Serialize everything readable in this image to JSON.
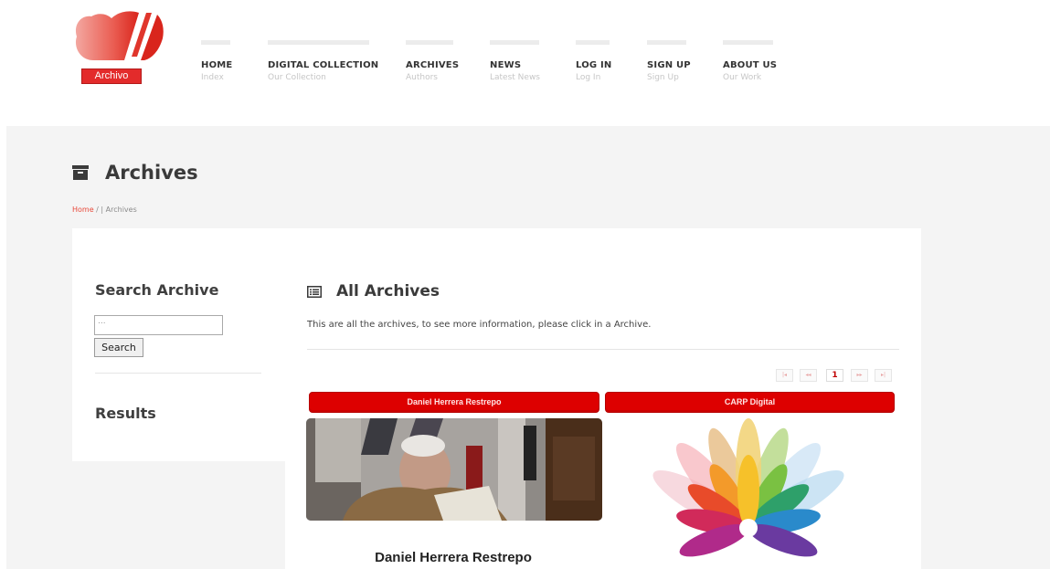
{
  "header": {
    "logo_text": "Archivo",
    "nav": [
      {
        "title": "HOME",
        "subtitle": "Index"
      },
      {
        "title": "DIGITAL COLLECTION",
        "subtitle": "Our Collection"
      },
      {
        "title": "ARCHIVES",
        "subtitle": "Authors"
      },
      {
        "title": "NEWS",
        "subtitle": "Latest News"
      },
      {
        "title": "LOG IN",
        "subtitle": "Log In"
      },
      {
        "title": "SIGN UP",
        "subtitle": "Sign Up"
      },
      {
        "title": "ABOUT US",
        "subtitle": "Our Work"
      }
    ]
  },
  "page": {
    "title": "Archives",
    "breadcrumb": {
      "home": "Home",
      "separator": "/  |",
      "current": "Archives"
    }
  },
  "sidebar": {
    "search_heading": "Search Archive",
    "search_placeholder": "...",
    "search_button": "Search",
    "results_heading": "Results"
  },
  "main": {
    "heading": "All Archives",
    "description": "This are all the archives, to see more information, please click in a Archive.",
    "pagination": {
      "first": "|◂",
      "prev": "◂◂",
      "current": "1",
      "next": "▸▸",
      "last": "▸|"
    },
    "cards": [
      {
        "tab_label": "Daniel Herrera Restrepo",
        "caption": "Daniel Herrera Restrepo"
      },
      {
        "tab_label": "CARP Digital"
      }
    ]
  },
  "colors": {
    "accent_red": "#dd0000",
    "breadcrumb_home": "#e84a3b",
    "band_bg": "#f4f4f4"
  }
}
